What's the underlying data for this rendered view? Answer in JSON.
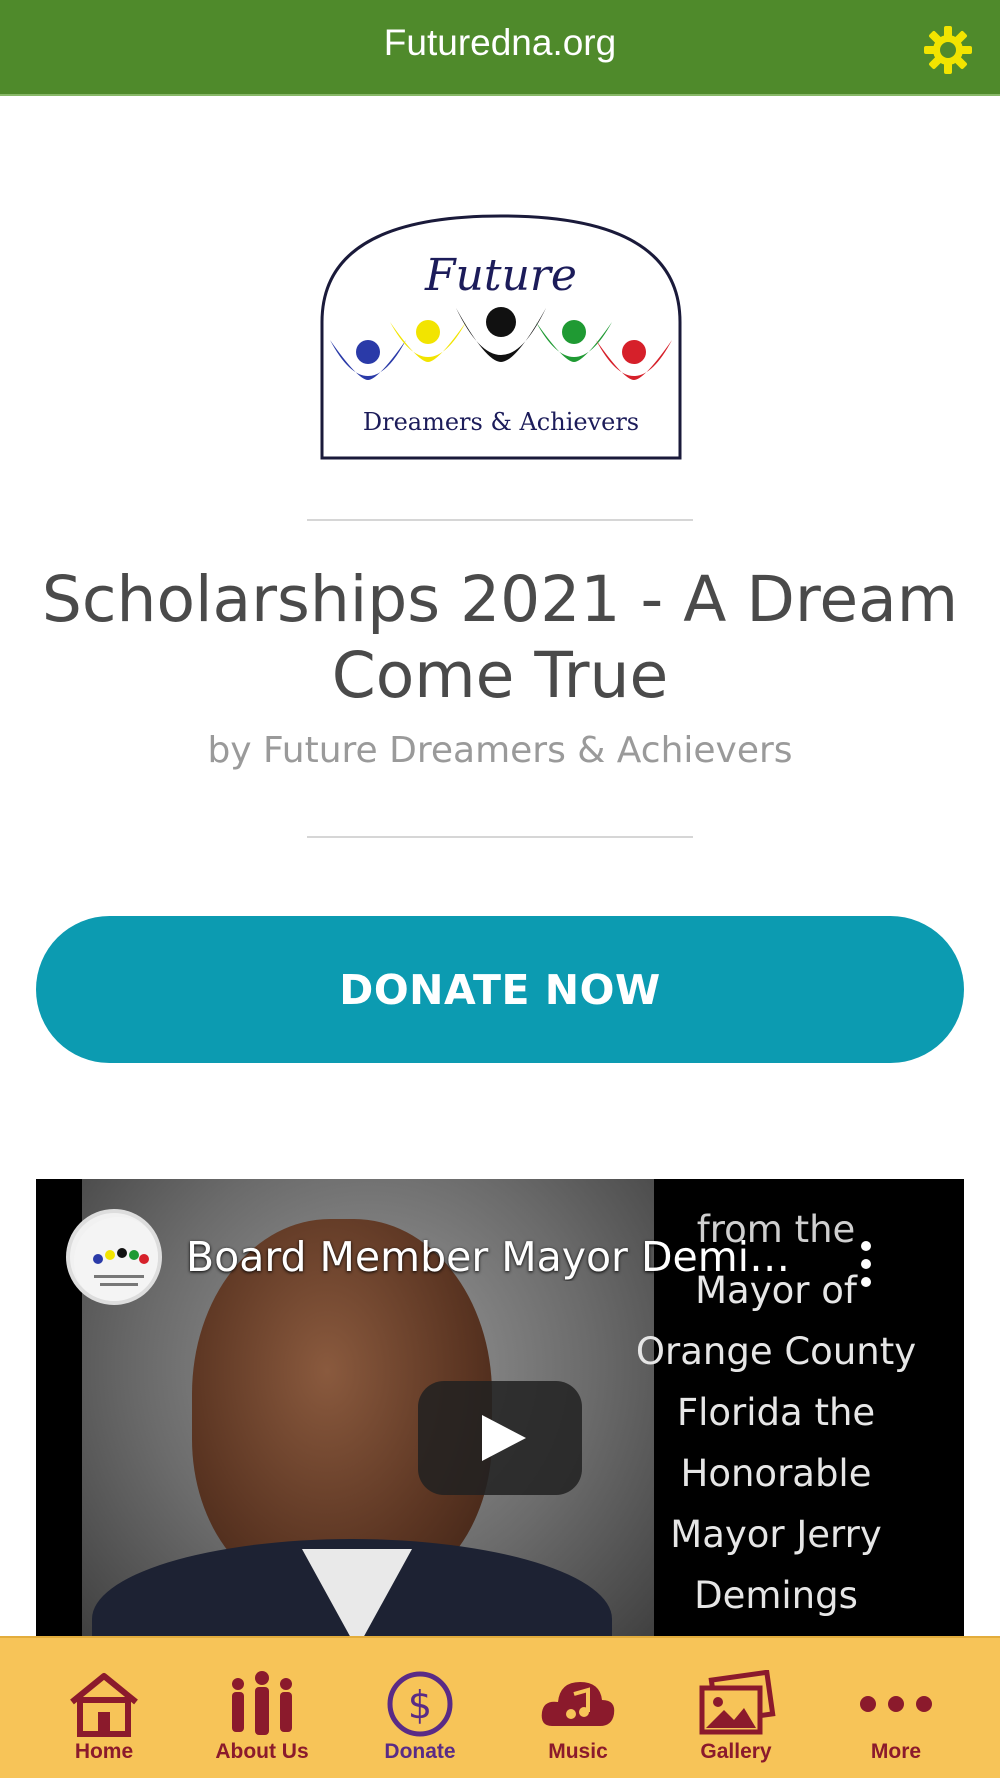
{
  "topbar": {
    "title": "Futuredna.org",
    "gear_color": "#f2e400"
  },
  "logo": {
    "top_text": "Future",
    "bottom_text": "Dreamers & Achievers"
  },
  "campaign": {
    "title": "Scholarships 2021 - A Dream Come True",
    "byline": "by Future Dreamers & Achievers"
  },
  "donate_button": {
    "label": "DONATE NOW",
    "color": "#0c9bb1"
  },
  "video": {
    "title": "Board Member Mayor Demings...",
    "caption_lines": [
      "from the",
      "Mayor of",
      "Orange County",
      "Florida the",
      "Honorable",
      "Mayor Jerry",
      "Demings"
    ]
  },
  "bottom_nav": {
    "items": [
      {
        "label": "Home",
        "icon": "home-icon"
      },
      {
        "label": "About Us",
        "icon": "people-icon"
      },
      {
        "label": "Donate",
        "icon": "dollar-icon",
        "active": true
      },
      {
        "label": "Music",
        "icon": "music-cloud-icon"
      },
      {
        "label": "Gallery",
        "icon": "gallery-icon"
      },
      {
        "label": "More",
        "icon": "more-icon"
      }
    ],
    "colors": {
      "background": "#f7c458",
      "item": "#8b1a2c",
      "active": "#5a2b86"
    }
  }
}
